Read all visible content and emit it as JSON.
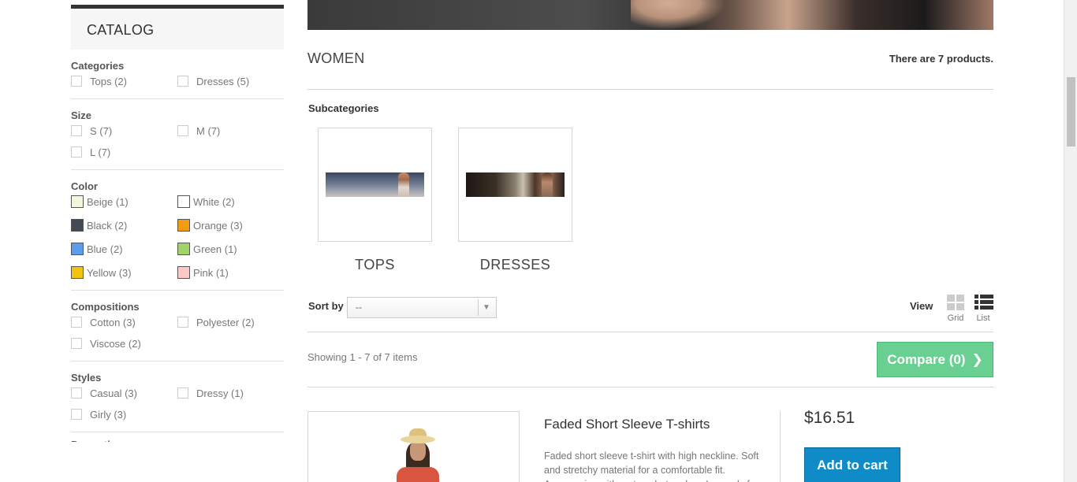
{
  "sidebar": {
    "catalog_title": "CATALOG",
    "categories": {
      "title": "Categories",
      "options": [
        "Tops (2)",
        "Dresses (5)"
      ]
    },
    "size": {
      "title": "Size",
      "options": [
        "S (7)",
        "M (7)",
        "L (7)"
      ]
    },
    "color": {
      "title": "Color",
      "options": [
        {
          "label": "Beige (1)",
          "swatch": "#f5f5dc"
        },
        {
          "label": "White (2)",
          "swatch": "#ffffff"
        },
        {
          "label": "Black (2)",
          "swatch": "#434a54"
        },
        {
          "label": "Orange (3)",
          "swatch": "#f39c11"
        },
        {
          "label": "Blue (2)",
          "swatch": "#5d9cec"
        },
        {
          "label": "Green (1)",
          "swatch": "#a0d468"
        },
        {
          "label": "Yellow (3)",
          "swatch": "#f1c40f"
        },
        {
          "label": "Pink (1)",
          "swatch": "#fcc8c8"
        }
      ]
    },
    "compositions": {
      "title": "Compositions",
      "options": [
        "Cotton (3)",
        "Polyester (2)",
        "Viscose (2)"
      ]
    },
    "styles": {
      "title": "Styles",
      "options": [
        "Casual (3)",
        "Dressy (1)",
        "Girly (3)"
      ]
    },
    "next_title_partial": "Properties"
  },
  "main": {
    "category_title": "WOMEN",
    "product_count": "There are 7 products.",
    "subcategories_title": "Subcategories",
    "subcategories": [
      "TOPS",
      "DRESSES"
    ],
    "sort_label": "Sort by",
    "sort_value": "--",
    "view_label": "View",
    "view_grid": "Grid",
    "view_list": "List",
    "showing": "Showing 1 - 7 of 7 items",
    "compare_label": "Compare (0)"
  },
  "product": {
    "name": "Faded Short Sleeve T-shirts",
    "description": "Faded short sleeve t-shirt with high neckline. Soft and stretchy material for a comfortable fit. Accessorize with a straw hat and you're ready for summer!",
    "price": "$16.51",
    "add_to_cart": "Add to cart"
  }
}
